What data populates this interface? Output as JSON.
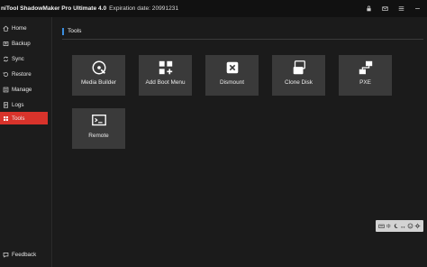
{
  "titlebar": {
    "app_title": "niTool ShadowMaker Pro Ultimate 4.0",
    "expiration": "Expiration date: 20991231"
  },
  "sidebar": {
    "items": [
      {
        "label": "Home",
        "icon": "home-icon",
        "active": false
      },
      {
        "label": "Backup",
        "icon": "backup-icon",
        "active": false
      },
      {
        "label": "Sync",
        "icon": "sync-icon",
        "active": false
      },
      {
        "label": "Restore",
        "icon": "restore-icon",
        "active": false
      },
      {
        "label": "Manage",
        "icon": "manage-icon",
        "active": false
      },
      {
        "label": "Logs",
        "icon": "logs-icon",
        "active": false
      },
      {
        "label": "Tools",
        "icon": "tools-icon",
        "active": true
      }
    ],
    "feedback": {
      "label": "Feedback",
      "icon": "feedback-icon"
    }
  },
  "main": {
    "section_title": "Tools",
    "tools": [
      {
        "label": "Media Builder",
        "icon": "media-builder-icon"
      },
      {
        "label": "Add Boot Menu",
        "icon": "add-boot-menu-icon"
      },
      {
        "label": "Dismount",
        "icon": "dismount-icon"
      },
      {
        "label": "Clone Disk",
        "icon": "clone-disk-icon"
      },
      {
        "label": "PXE",
        "icon": "pxe-icon"
      },
      {
        "label": "Remote",
        "icon": "remote-icon"
      }
    ]
  },
  "colors": {
    "accent_active": "#d8332b",
    "section_accent": "#3a8dde",
    "tile_bg": "#3a3a3a",
    "app_bg": "#1b1b1b"
  }
}
